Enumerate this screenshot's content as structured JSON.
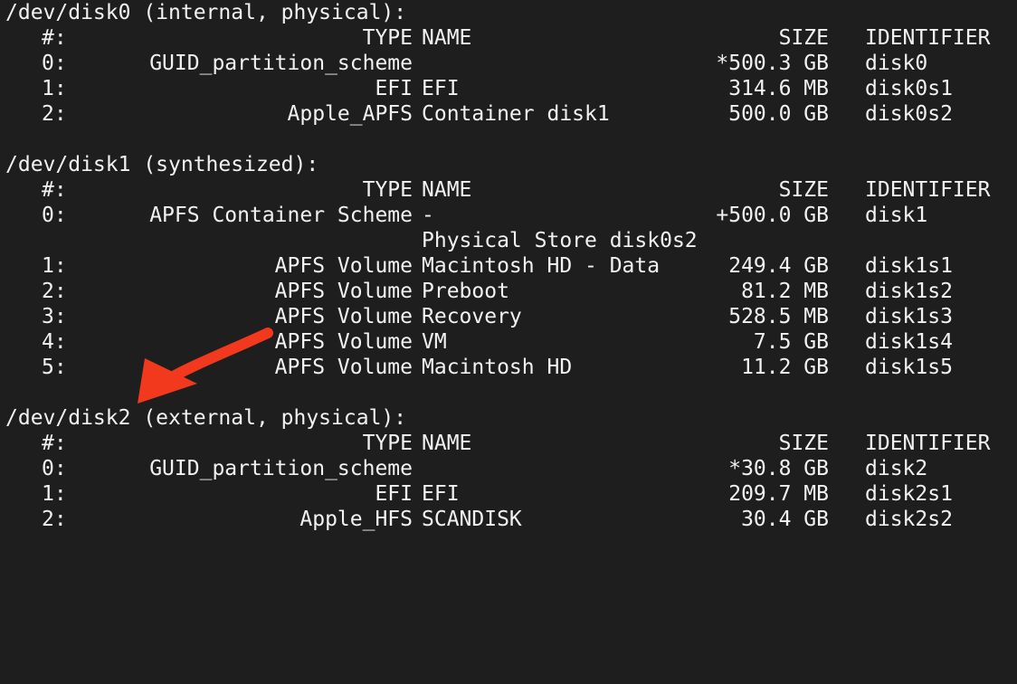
{
  "colors": {
    "background": "#1e1e1e",
    "text": "#f2f2f2",
    "arrow": "#f2391e"
  },
  "annotation": {
    "icon": "red-arrow-icon"
  },
  "disks": [
    {
      "header": "/dev/disk0 (internal, physical):",
      "columns": {
        "num": "#:",
        "type": "TYPE",
        "name": "NAME",
        "size": "SIZE",
        "id": "IDENTIFIER"
      },
      "rows": [
        {
          "num": "0:",
          "type": "GUID_partition_scheme",
          "name": "",
          "size": "*500.3 GB",
          "id": "disk0"
        },
        {
          "num": "1:",
          "type": "EFI",
          "name": "EFI",
          "size": "314.6 MB",
          "id": "disk0s1"
        },
        {
          "num": "2:",
          "type": "Apple_APFS",
          "name": "Container disk1",
          "size": "500.0 GB",
          "id": "disk0s2"
        }
      ]
    },
    {
      "header": "/dev/disk1 (synthesized):",
      "columns": {
        "num": "#:",
        "type": "TYPE",
        "name": "NAME",
        "size": "SIZE",
        "id": "IDENTIFIER"
      },
      "rows": [
        {
          "num": "0:",
          "type": "APFS Container Scheme",
          "name": "-",
          "size": "+500.0 GB",
          "id": "disk1"
        },
        {
          "num": "",
          "type": "",
          "name": "Physical Store disk0s2",
          "size": "",
          "id": ""
        },
        {
          "num": "1:",
          "type": "APFS Volume",
          "name": "Macintosh HD - Data",
          "size": "249.4 GB",
          "id": "disk1s1"
        },
        {
          "num": "2:",
          "type": "APFS Volume",
          "name": "Preboot",
          "size": "81.2 MB",
          "id": "disk1s2"
        },
        {
          "num": "3:",
          "type": "APFS Volume",
          "name": "Recovery",
          "size": "528.5 MB",
          "id": "disk1s3"
        },
        {
          "num": "4:",
          "type": "APFS Volume",
          "name": "VM",
          "size": "7.5 GB",
          "id": "disk1s4"
        },
        {
          "num": "5:",
          "type": "APFS Volume",
          "name": "Macintosh HD",
          "size": "11.2 GB",
          "id": "disk1s5"
        }
      ]
    },
    {
      "header": "/dev/disk2 (external, physical):",
      "columns": {
        "num": "#:",
        "type": "TYPE",
        "name": "NAME",
        "size": "SIZE",
        "id": "IDENTIFIER"
      },
      "rows": [
        {
          "num": "0:",
          "type": "GUID_partition_scheme",
          "name": "",
          "size": "*30.8 GB",
          "id": "disk2"
        },
        {
          "num": "1:",
          "type": "EFI",
          "name": "EFI",
          "size": "209.7 MB",
          "id": "disk2s1"
        },
        {
          "num": "2:",
          "type": "Apple_HFS",
          "name": "SCANDISK",
          "size": "30.4 GB",
          "id": "disk2s2"
        }
      ]
    }
  ]
}
